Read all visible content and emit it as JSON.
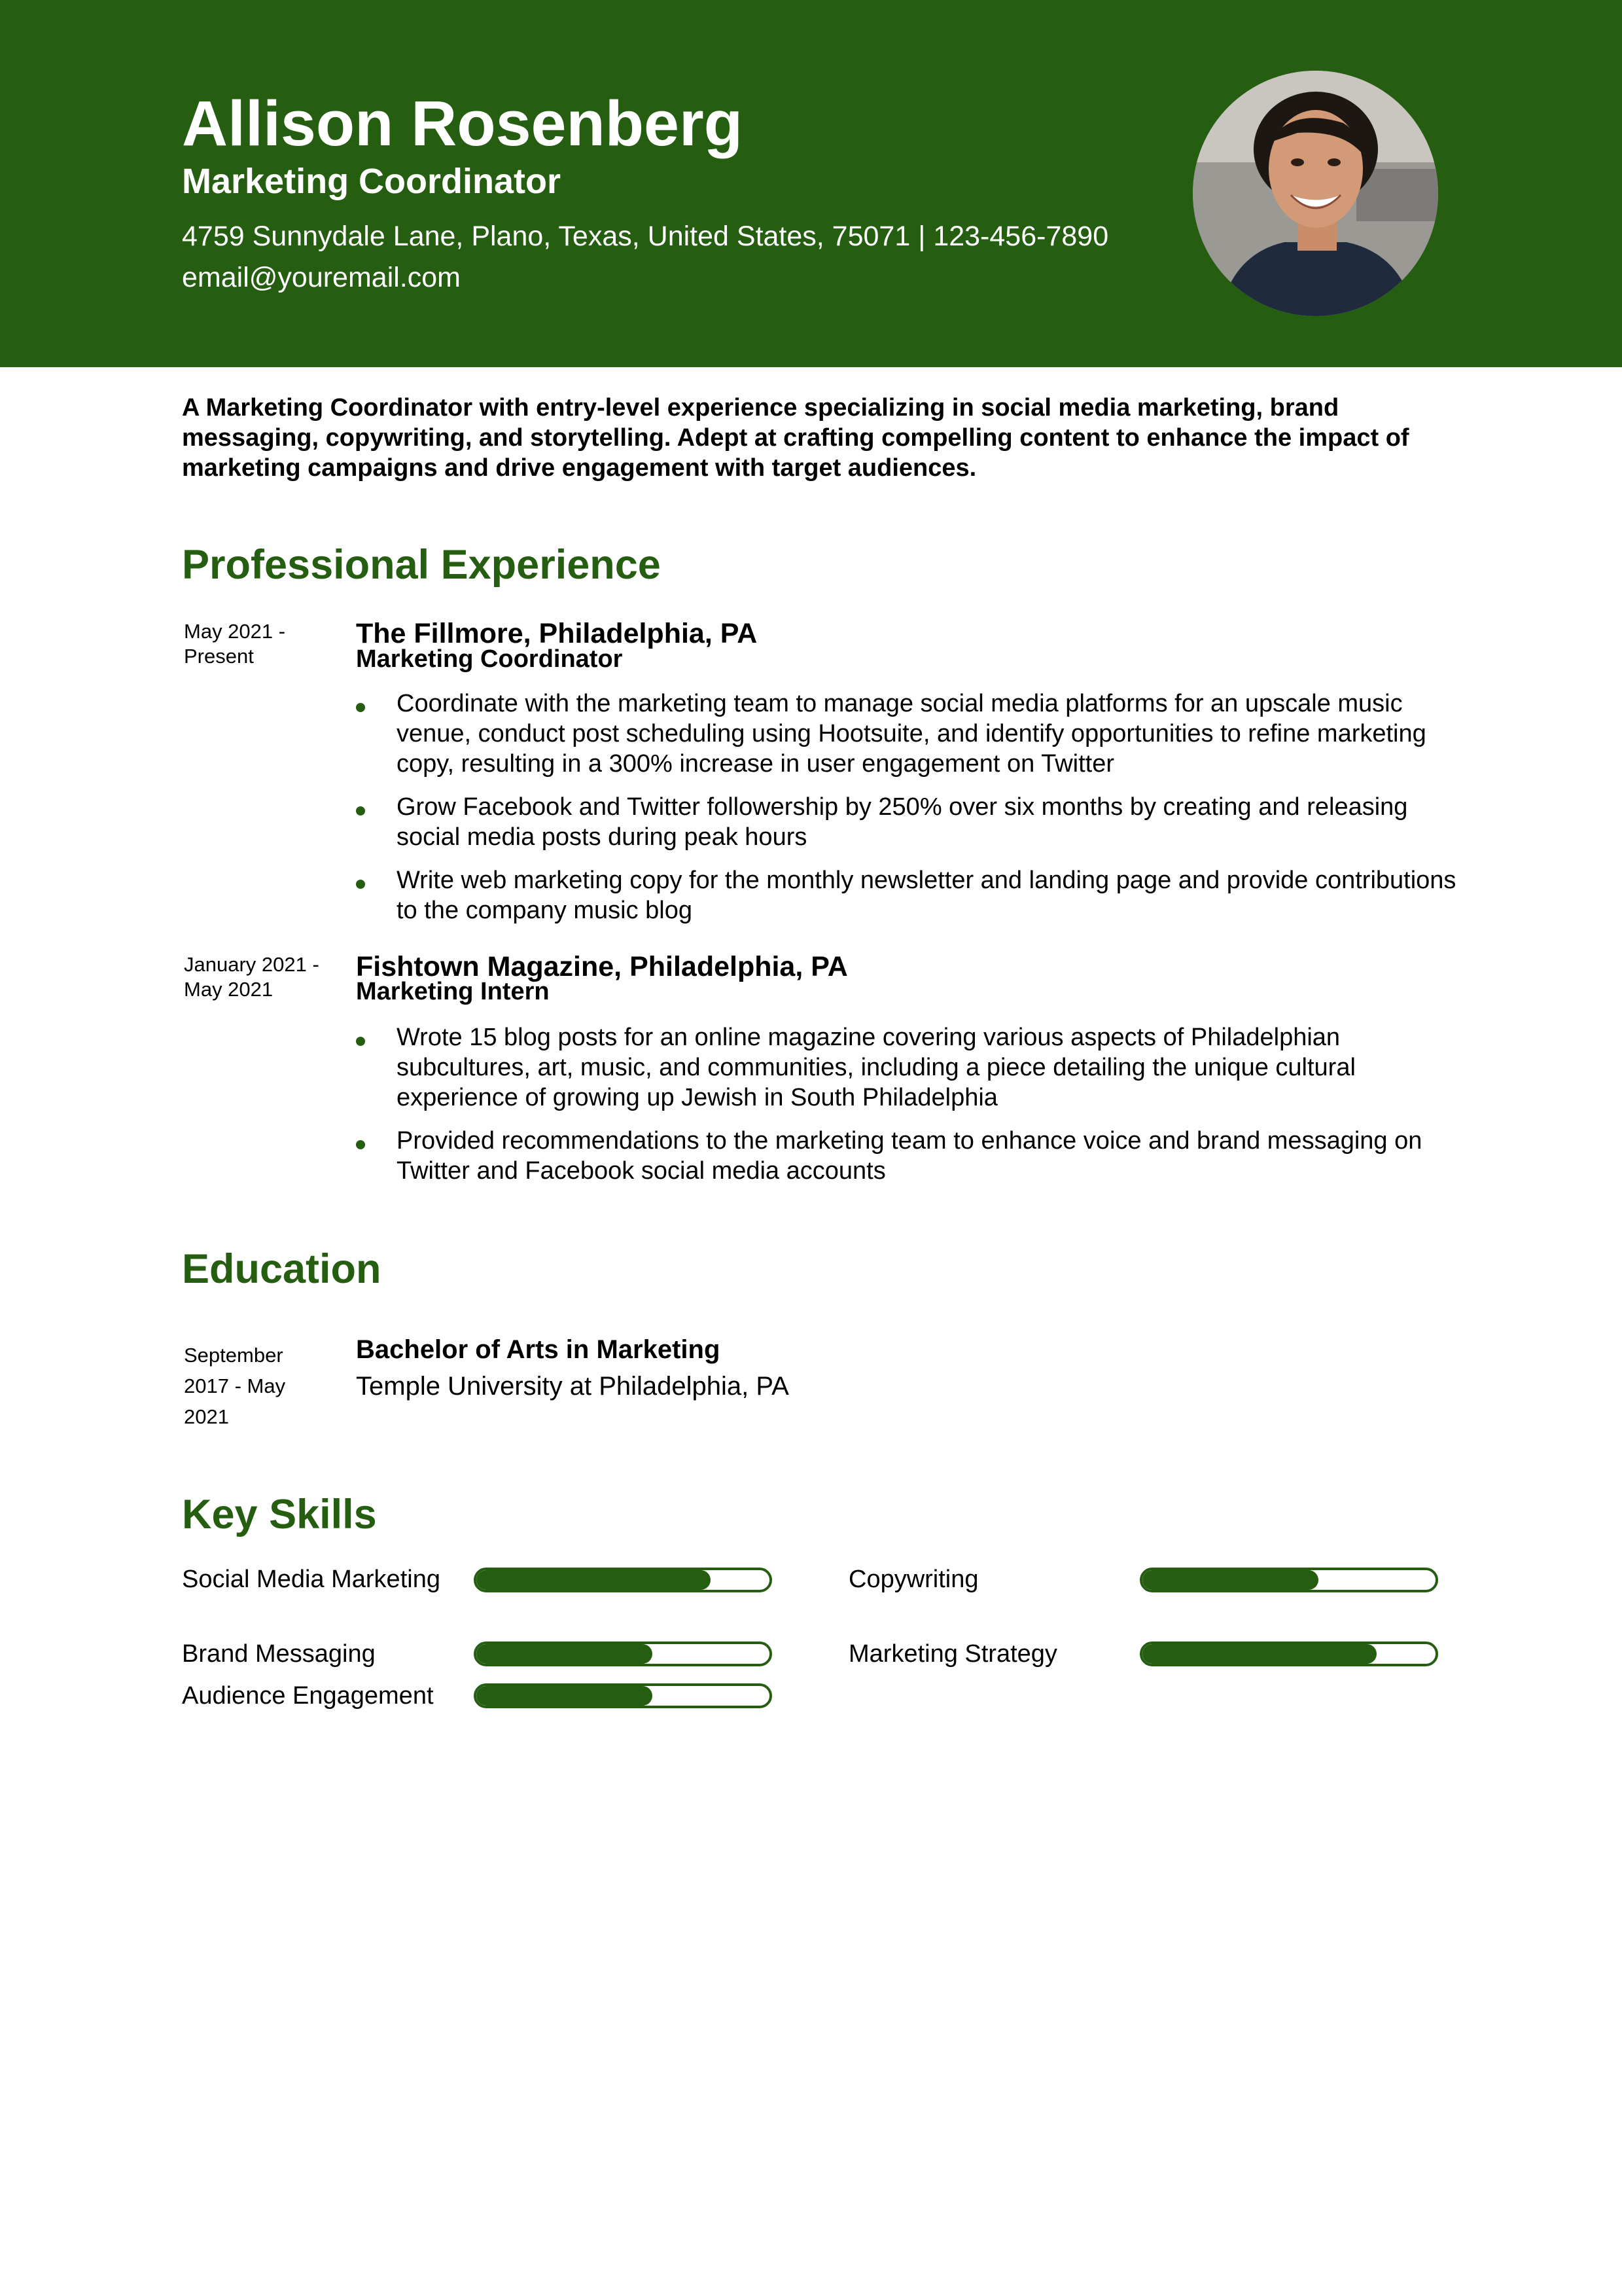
{
  "header": {
    "name": "Allison Rosenberg",
    "title": "Marketing Coordinator",
    "contact_line1": "4759 Sunnydale Lane, Plano, Texas, United States, 75071 | 123-456-7890",
    "contact_line2": "email@youremail.com",
    "accent_color": "#265e11"
  },
  "summary": "A Marketing Coordinator with entry-level experience specializing in  social media marketing, brand messaging, copywriting, and storytelling.  Adept at crafting compelling content to enhance the impact of marketing  campaigns and drive engagement with target audiences.",
  "experience": {
    "heading": "Professional Experience",
    "jobs": [
      {
        "dates": "May 2021 - Present",
        "company": "The Fillmore, Philadelphia, PA",
        "role": "Marketing Coordinator",
        "bullets": [
          "Coordinate with the marketing team to manage social media platforms  for an upscale music venue, conduct post scheduling using Hootsuite, and  identify opportunities to refine marketing copy, resulting in a 300%  increase in user engagement on Twitter",
          "Grow Facebook and Twitter followership by 250% over six months by creating and releasing social media posts during peak hours",
          "Write web marketing copy for the monthly newsletter and landing page and provide contributions to the company music blog"
        ]
      },
      {
        "dates": "January 2021 - May 2021",
        "company": "Fishtown Magazine, Philadelphia, PA",
        "role": "Marketing Intern",
        "bullets": [
          "Wrote 15 blog posts for an online magazine covering various aspects  of Philadelphian subcultures, art, music, and communities, including a  piece detailing the unique cultural experience of growing up Jewish in  South Philadelphia",
          "Provided recommendations to the marketing team to enhance voice and  brand messaging on Twitter and Facebook social media accounts"
        ]
      }
    ]
  },
  "education": {
    "heading": "Education",
    "dates": "September 2017 - May 2021",
    "degree": "Bachelor of Arts in Marketing",
    "school": "Temple University at Philadelphia, PA"
  },
  "skills": {
    "heading": "Key Skills",
    "items": [
      {
        "label": "Social Media Marketing",
        "level": 0.8
      },
      {
        "label": "Copywriting",
        "level": 0.6
      },
      {
        "label": "Brand Messaging",
        "level": 0.6
      },
      {
        "label": "Marketing Strategy",
        "level": 0.8
      },
      {
        "label": "Audience Engagement",
        "level": 0.6
      }
    ]
  }
}
